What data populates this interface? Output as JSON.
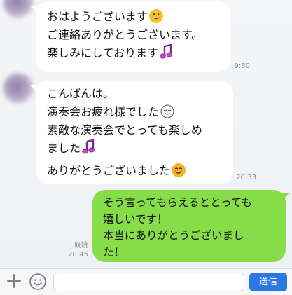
{
  "messages": {
    "m1": {
      "lines": [
        "おはようございます",
        "ご連絡ありがとうございます。",
        "楽しみにしております"
      ],
      "time": "9:30"
    },
    "m2": {
      "lines": [
        "こんばんは。",
        "演奏会お疲れ様でした",
        "素敵な演奏会でとっても楽しめ",
        "ました",
        "ありがとうございました"
      ],
      "time": "20:33"
    },
    "m3": {
      "lines": [
        "そう言ってもらえるととっても",
        "嬉しいです！",
        "本当にありがとうございまし",
        "た！"
      ],
      "read": "既読",
      "time": "20:45"
    }
  },
  "toolbar": {
    "input_value": "",
    "send_label": "送信"
  },
  "icons": {
    "add": "plus-icon",
    "emoji": "emoji-icon",
    "grin": "grinning-face-emoji",
    "note": "music-note-emoji",
    "relieved": "relieved-face-emoji",
    "blush": "smiling-blush-emoji"
  },
  "colors": {
    "incoming_bubble": "#ffffff",
    "outgoing_bubble": "#86dd47",
    "send_button": "#2b78e4",
    "note_emoji": "#b040c8"
  }
}
